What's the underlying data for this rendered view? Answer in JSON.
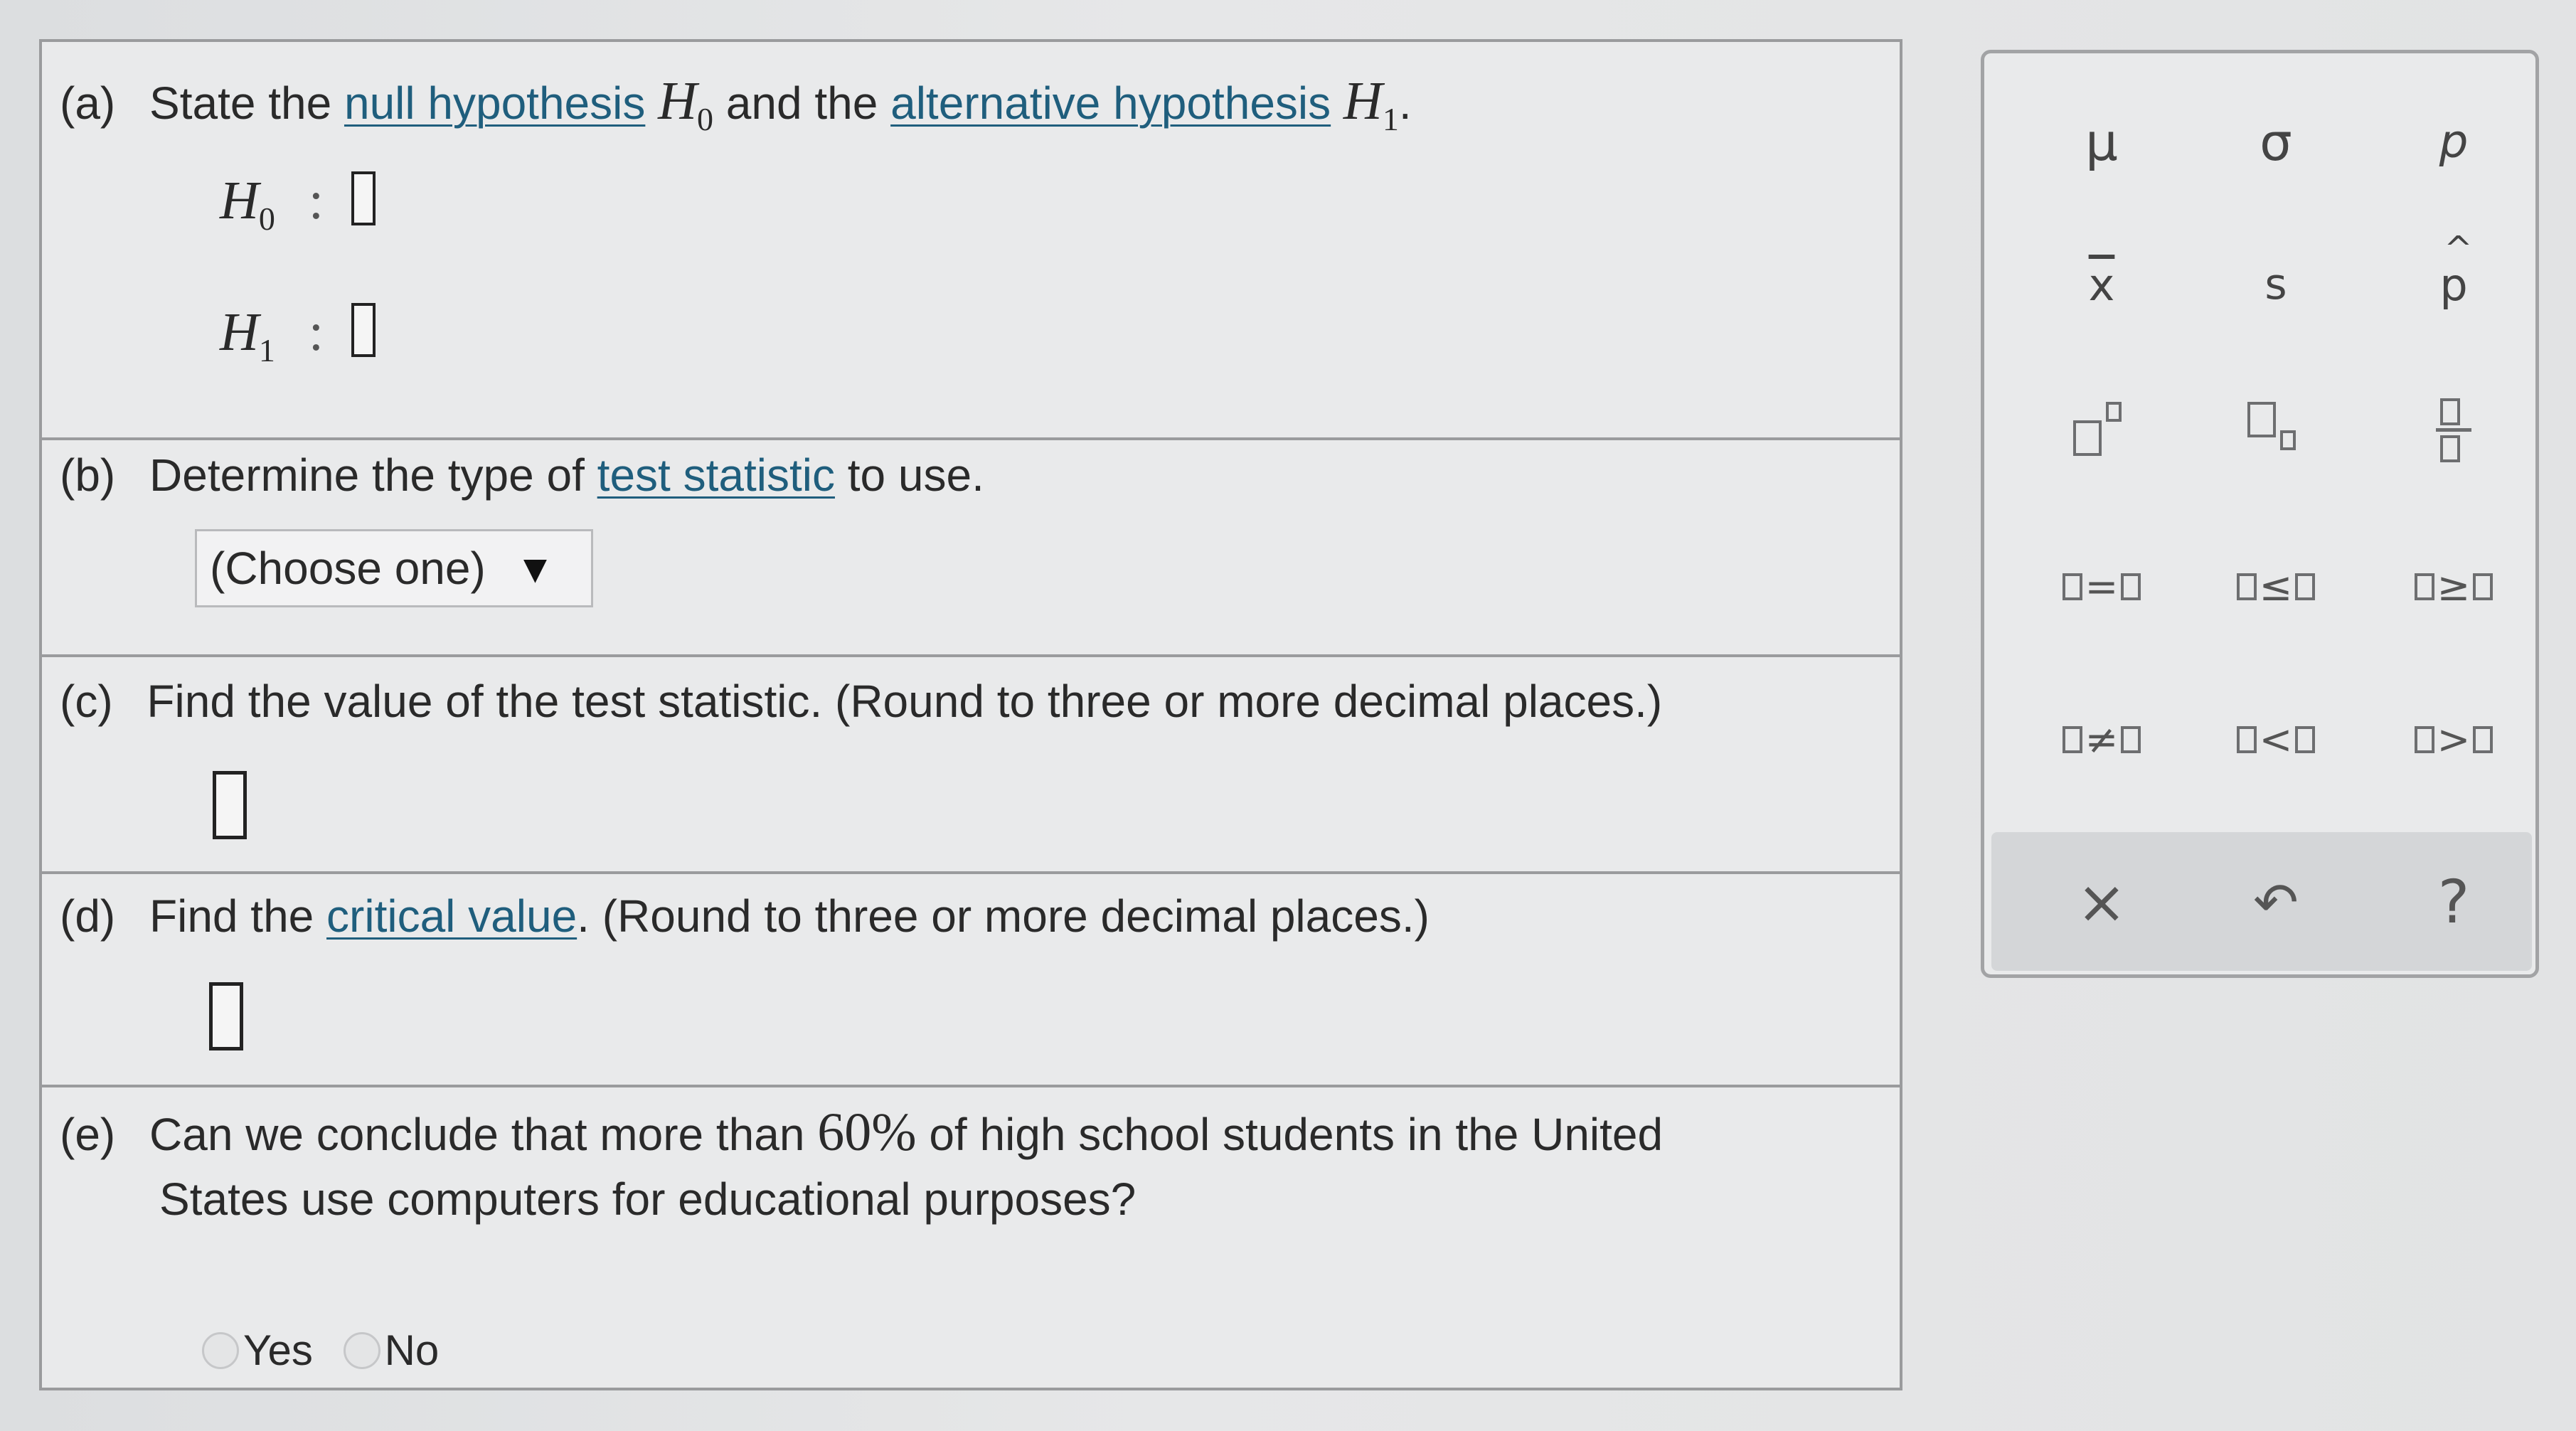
{
  "questions": {
    "a": {
      "tag": "(a)",
      "text_1": "State the",
      "link_null": "null hypothesis",
      "h0_symbol": "H",
      "h0_sub": "0",
      "text_2": "and the",
      "link_alt": "alternative hypothesis",
      "h1_symbol": "H",
      "h1_sub": "1",
      "period": ".",
      "h0_label": "H",
      "h0_label_sub": "0",
      "h1_label": "H",
      "h1_label_sub": "1",
      "colon": ":"
    },
    "b": {
      "tag": "(b)",
      "text_1": "Determine the type of",
      "link": "test statistic",
      "text_2": "to use.",
      "dropdown_value": "(Choose one)",
      "dropdown_caret": "▼"
    },
    "c": {
      "tag": "(c)",
      "text": "Find the value of the test statistic. (Round to three or more decimal places.)"
    },
    "d": {
      "tag": "(d)",
      "text_1": "Find the",
      "link": "critical value",
      "text_2": ". (Round to three or more decimal places.)"
    },
    "e": {
      "tag": "(e)",
      "line_1_a": "Can we conclude that more than",
      "percent": "60%",
      "line_1_b": "of high school students in the United",
      "line_2": "States use computers for educational purposes?",
      "option_yes": "Yes",
      "option_no": "No"
    }
  },
  "palette": {
    "mu": "μ",
    "sigma": "σ",
    "p": "p",
    "xbar": "x",
    "s": "s",
    "phat": "p",
    "op_eq": "=",
    "op_le": "≤",
    "op_ge": "≥",
    "op_ne": "≠",
    "op_lt": "<",
    "op_gt": ">",
    "clear": "×",
    "undo": "↶",
    "help": "?"
  },
  "icons": {
    "clear": "close-icon",
    "undo": "undo-icon",
    "help": "help-icon",
    "caret": "caret-down-icon"
  }
}
